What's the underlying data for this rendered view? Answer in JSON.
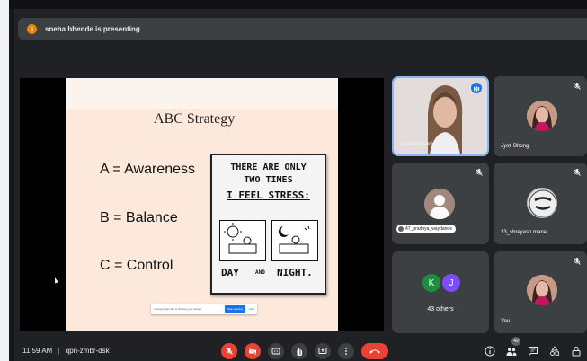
{
  "banner": {
    "presenter_initial": "s",
    "text": "sneha bhende is presenting"
  },
  "slide": {
    "title": "ABC Strategy",
    "lines": [
      "A = Awareness",
      "B = Balance",
      "C = Control"
    ],
    "cartoon": {
      "line1": "THERE ARE ONLY",
      "line2": "TWO TIMES",
      "line3": "I FEEL STRESS:",
      "left_caption": "DAY",
      "mid_caption": "AND",
      "right_caption": "NIGHT."
    },
    "share_bar": {
      "text": "meet.google.com is sharing your screen.",
      "stop_label": "Stop sharing",
      "hide_label": "Hide"
    }
  },
  "participants": [
    {
      "name": "sneha bhende",
      "role": "presenter-video"
    },
    {
      "name": "Jyoti Bhong"
    },
    {
      "name": "47_pradnya_waydande"
    },
    {
      "name": "13_shreyash mane"
    },
    {
      "name": "43 others",
      "avatars": [
        "K",
        "J"
      ]
    },
    {
      "name": "You"
    }
  ],
  "bottom": {
    "time": "11:59 AM",
    "separator": "|",
    "meeting_code": "qpn-zmbr-dsk",
    "people_count": "49"
  },
  "colors": {
    "background": "#202124",
    "tile": "#3c4043",
    "danger": "#ea4335",
    "accent": "#1a73e8",
    "avatar_k": "#1e8e3e",
    "avatar_j": "#7c4dff"
  }
}
